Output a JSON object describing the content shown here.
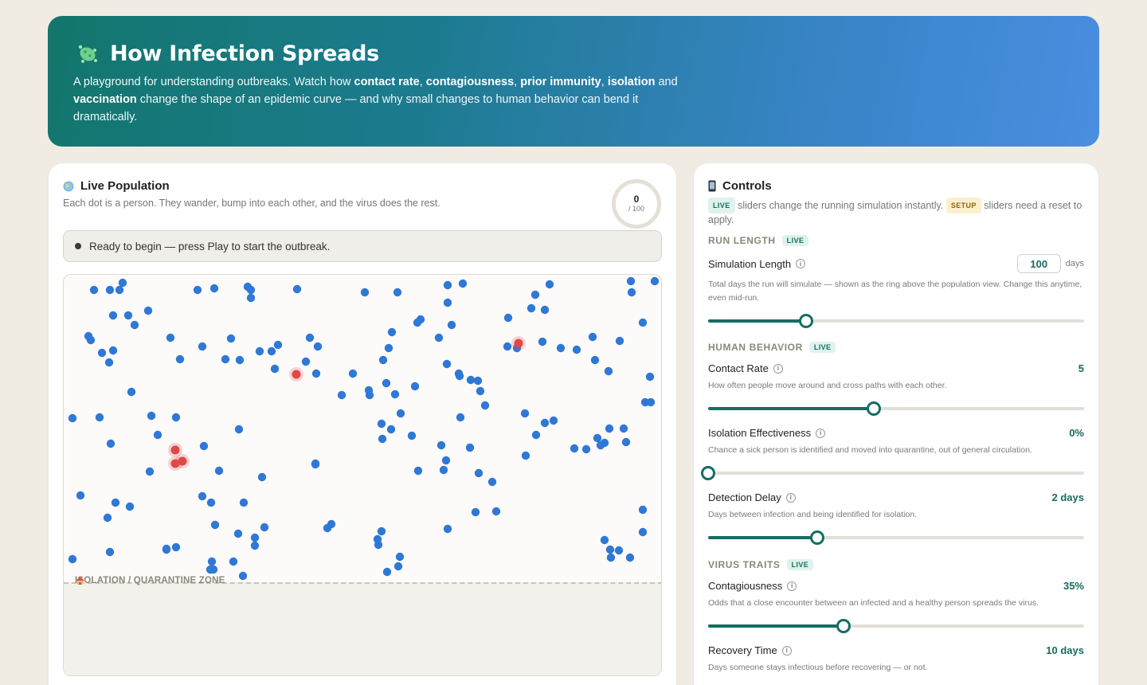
{
  "hero": {
    "title": "How Infection Spreads",
    "desc_parts": [
      {
        "t": "A playground for understanding outbreaks. Watch how ",
        "b": false
      },
      {
        "t": "contact rate",
        "b": true
      },
      {
        "t": ", ",
        "b": false
      },
      {
        "t": "contagiousness",
        "b": true
      },
      {
        "t": ", ",
        "b": false
      },
      {
        "t": "prior immunity",
        "b": true
      },
      {
        "t": ", ",
        "b": false
      },
      {
        "t": "isolation",
        "b": true
      },
      {
        "t": " and ",
        "b": false
      },
      {
        "t": "vaccination",
        "b": true
      },
      {
        "t": " change the shape of an epidemic curve — and why small changes to human behavior can bend it dramatically.",
        "b": false
      }
    ]
  },
  "population": {
    "title": "Live Population",
    "subtitle": "Each dot is a person. They wander, bump into each other, and the virus does the rest.",
    "day": "0",
    "day_total": "/ 100",
    "status": "Ready to begin — press Play to start the outbreak.",
    "quarantine_label": "ISOLATION / QUARANTINE ZONE",
    "colors": {
      "healthy": "#2f78d6",
      "infected": "#e04848"
    }
  },
  "controls": {
    "title": "Controls",
    "live_tag": "LIVE",
    "setup_tag": "SETUP",
    "sub_a": " sliders change the running simulation instantly. ",
    "sub_b": " sliders need a reset to apply.",
    "sections": {
      "run_length": "RUN LENGTH",
      "human_behavior": "HUMAN BEHAVIOR",
      "virus_traits": "VIRUS TRAITS"
    },
    "sim_length": {
      "label": "Simulation Length",
      "value": "100",
      "unit": "days",
      "desc": "Total days the run will simulate — shown as the ring above the population view. Change this anytime, even mid-run.",
      "level": 0.26
    },
    "contact_rate": {
      "label": "Contact Rate",
      "value": "5",
      "desc": "How often people move around and cross paths with each other.",
      "level": 0.44
    },
    "isolation": {
      "label": "Isolation Effectiveness",
      "value": "0%",
      "desc": "Chance a sick person is identified and moved into quarantine, out of general circulation.",
      "level": 0.0
    },
    "detection_delay": {
      "label": "Detection Delay",
      "value": "2 days",
      "desc": "Days between infection and being identified for isolation.",
      "level": 0.29
    },
    "contagiousness": {
      "label": "Contagiousness",
      "value": "35%",
      "desc": "Odds that a close encounter between an infected and a healthy person spreads the virus.",
      "level": 0.36
    },
    "recovery_time": {
      "label": "Recovery Time",
      "value": "10 days",
      "desc": "Days someone stays infectious before recovering — or not."
    }
  }
}
